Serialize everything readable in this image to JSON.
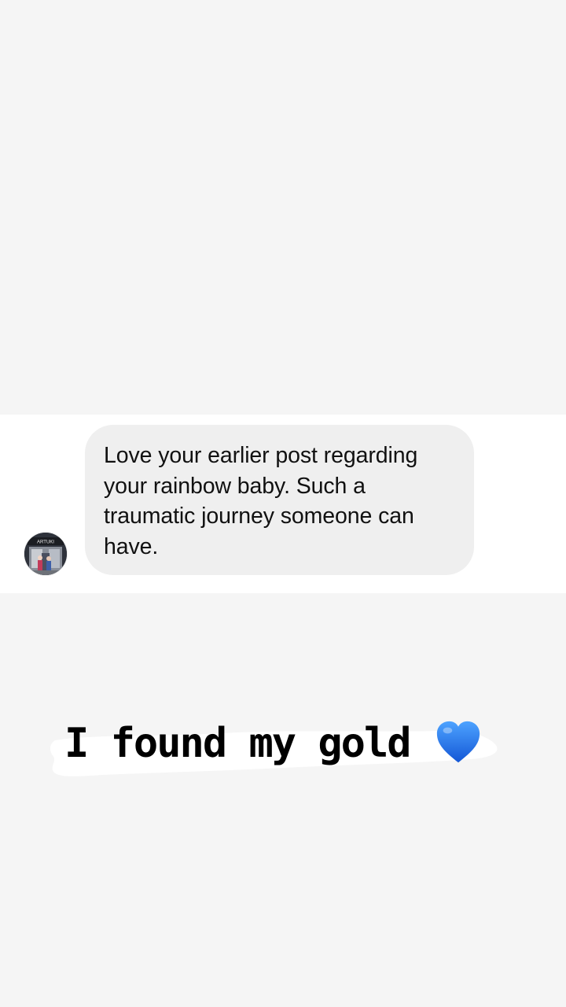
{
  "message": {
    "text": "Love your earlier post regarding your rainbow baby. Such a traumatic journey someone can have.",
    "avatar_label": "ARTUKI"
  },
  "caption": {
    "text": "I found my gold",
    "emoji": "blue-heart-icon"
  },
  "colors": {
    "background": "#f5f5f5",
    "strip": "#ffffff",
    "bubble": "#efefef",
    "heart": "#1e6fe8"
  }
}
